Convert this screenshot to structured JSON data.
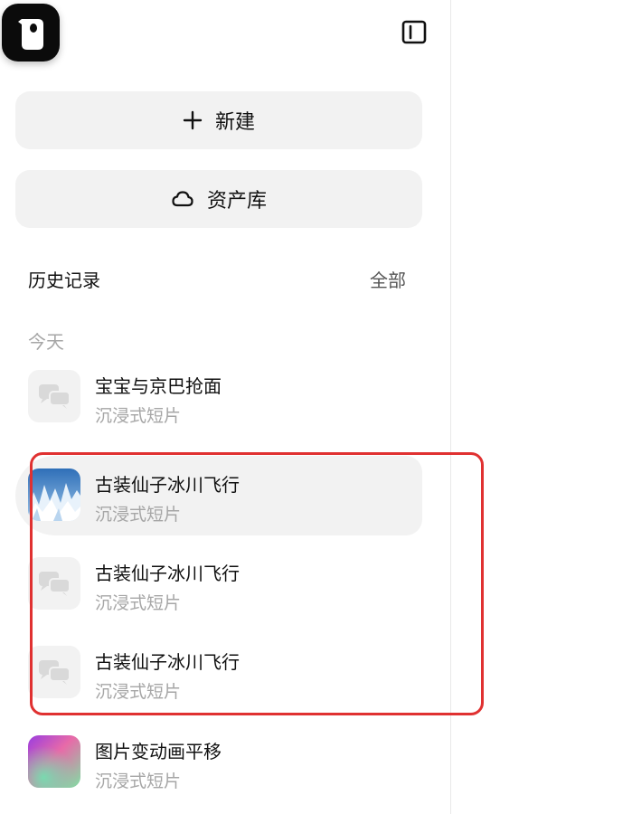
{
  "sidebar": {
    "new_button": {
      "label": "新建",
      "icon": "plus-icon"
    },
    "assets_button": {
      "label": "资产库",
      "icon": "cloud-icon"
    },
    "collapse_icon": "sidebar-toggle-icon",
    "app_logo_icon": "app-logo-icon"
  },
  "history": {
    "title": "历史记录",
    "all_link": "全部",
    "group_label": "今天",
    "items": [
      {
        "title": "宝宝与京巴抢面",
        "subtitle": "沉浸式短片",
        "thumb": "chat-bubbles-icon",
        "active": false
      },
      {
        "title": "古装仙子冰川飞行",
        "subtitle": "沉浸式短片",
        "thumb": "glacier-image",
        "active": true
      },
      {
        "title": "古装仙子冰川飞行",
        "subtitle": "沉浸式短片",
        "thumb": "chat-bubbles-icon",
        "active": false
      },
      {
        "title": "古装仙子冰川飞行",
        "subtitle": "沉浸式短片",
        "thumb": "chat-bubbles-icon",
        "active": false
      },
      {
        "title": "图片变动画平移",
        "subtitle": "沉浸式短片",
        "thumb": "gradient-image",
        "active": false
      }
    ]
  },
  "colors": {
    "highlight": "#e03131",
    "button_bg": "#f2f2f2",
    "muted_text": "#a6a6a6"
  }
}
